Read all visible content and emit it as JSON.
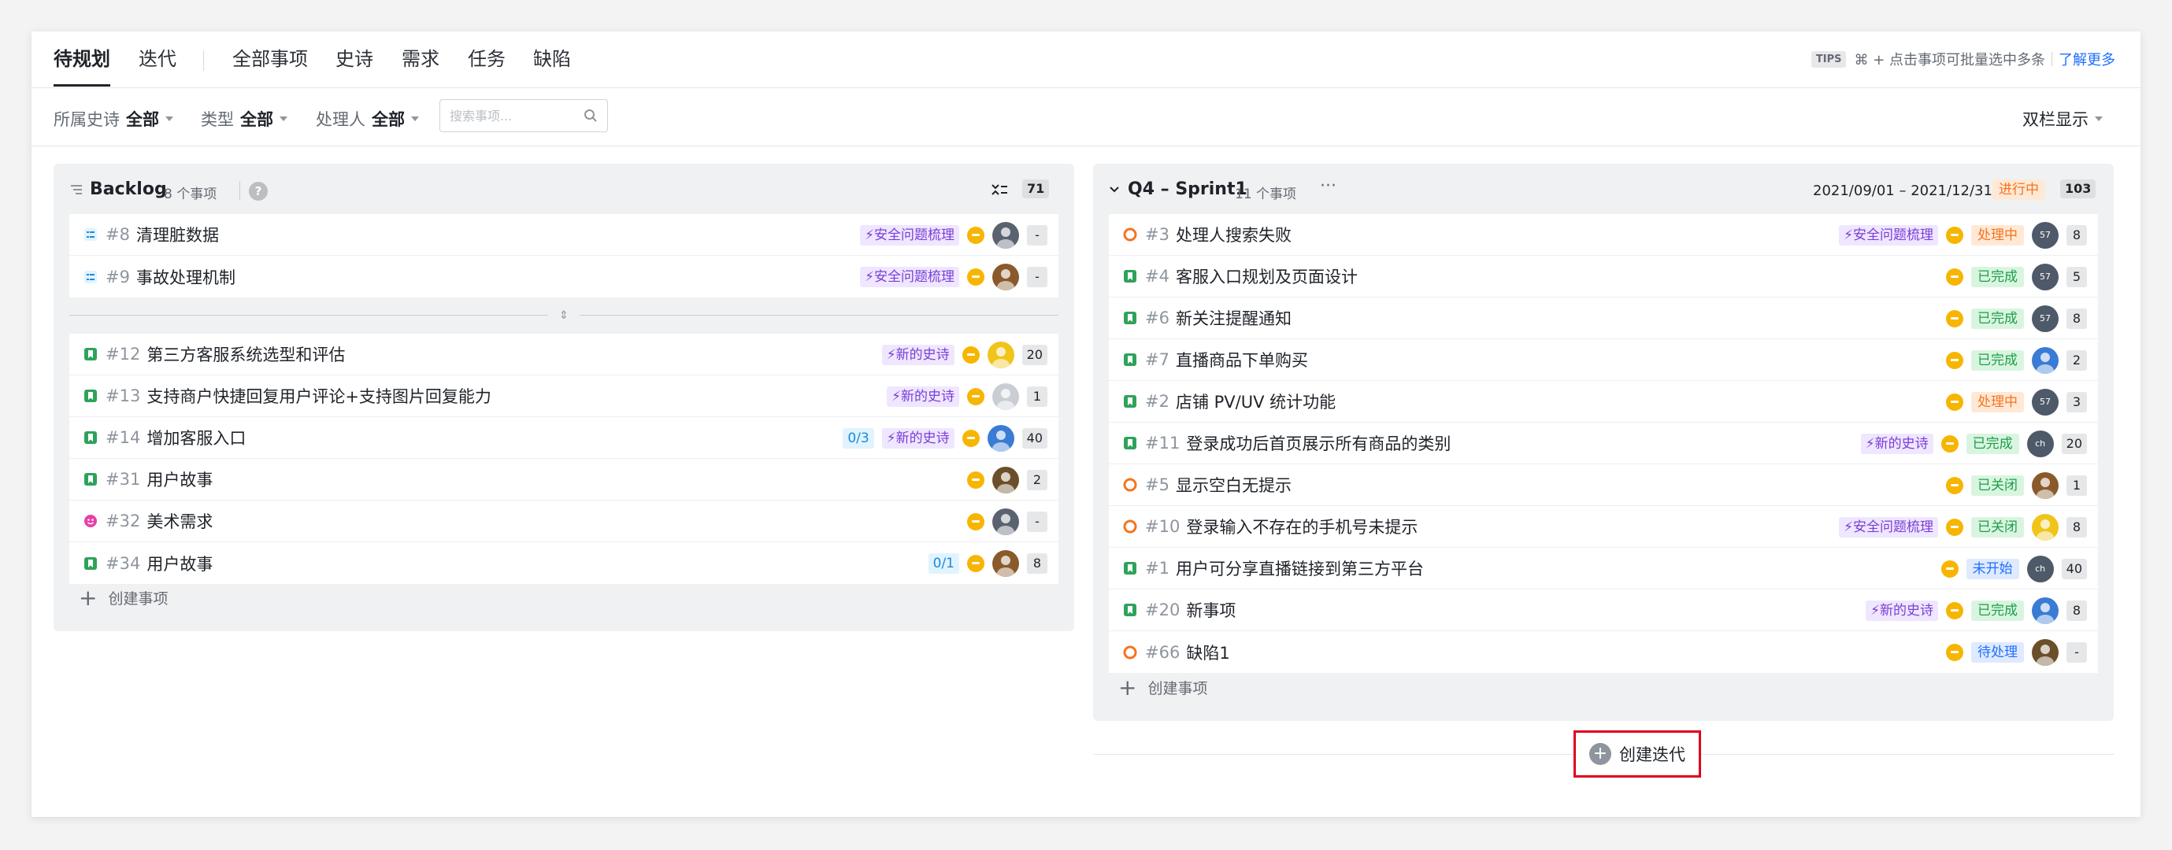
{
  "tabs": [
    "待规划",
    "迭代",
    "全部事项",
    "史诗",
    "需求",
    "任务",
    "缺陷"
  ],
  "tips": {
    "badge": "TIPS",
    "text": "⌘ + 点击事项可批量选中多条",
    "link": "了解更多"
  },
  "filters": {
    "epic_label": "所属史诗",
    "epic_value": "全部",
    "type_label": "类型",
    "type_value": "全部",
    "assignee_label": "处理人",
    "assignee_value": "全部",
    "search_placeholder": "搜索事项...",
    "view_mode": "双栏显示"
  },
  "backlog": {
    "title": "Backlog",
    "count": "8 个事项",
    "total": "71",
    "create_label": "创建事项",
    "rows_top": [
      {
        "id": "#8",
        "title": "清理脏数据",
        "epic": "安全问题梳理",
        "estimate": "-",
        "type": "task"
      },
      {
        "id": "#9",
        "title": "事故处理机制",
        "epic": "安全问题梳理",
        "estimate": "-",
        "type": "task"
      }
    ],
    "rows_bottom": [
      {
        "id": "#12",
        "title": "第三方客服系统选型和评估",
        "epic": "新的史诗",
        "sub": "",
        "estimate": "20",
        "type": "story"
      },
      {
        "id": "#13",
        "title": "支持商户快捷回复用户评论+支持图片回复能力",
        "epic": "新的史诗",
        "sub": "",
        "estimate": "1",
        "type": "story"
      },
      {
        "id": "#14",
        "title": "增加客服入口",
        "epic": "新的史诗",
        "sub": "0/3",
        "estimate": "40",
        "type": "story"
      },
      {
        "id": "#31",
        "title": "用户故事",
        "epic": "",
        "sub": "",
        "estimate": "2",
        "type": "story"
      },
      {
        "id": "#32",
        "title": "美术需求",
        "epic": "",
        "sub": "",
        "estimate": "-",
        "type": "art"
      },
      {
        "id": "#34",
        "title": "用户故事",
        "epic": "",
        "sub": "0/1",
        "estimate": "8",
        "type": "story"
      }
    ]
  },
  "sprint": {
    "title": "Q4 – Sprint1",
    "count": "11 个事项",
    "more": "···",
    "dates": "2021/09/01 – 2021/12/31",
    "state": "进行中",
    "total": "103",
    "create_label": "创建事项",
    "rows": [
      {
        "id": "#3",
        "title": "处理人搜索失败",
        "epic": "安全问题梳理",
        "status": "处理中",
        "status_color": "orange",
        "estimate": "8",
        "type": "bug",
        "avatar": "57"
      },
      {
        "id": "#4",
        "title": "客服入口规划及页面设计",
        "epic": "",
        "status": "已完成",
        "status_color": "green",
        "estimate": "5",
        "type": "story",
        "avatar": "57"
      },
      {
        "id": "#6",
        "title": "新关注提醒通知",
        "epic": "",
        "status": "已完成",
        "status_color": "green",
        "estimate": "8",
        "type": "story",
        "avatar": "57"
      },
      {
        "id": "#7",
        "title": "直播商品下单购买",
        "epic": "",
        "status": "已完成",
        "status_color": "green",
        "estimate": "2",
        "type": "story",
        "avatar": ""
      },
      {
        "id": "#2",
        "title": "店铺 PV/UV 统计功能",
        "epic": "",
        "status": "处理中",
        "status_color": "orange",
        "estimate": "3",
        "type": "story",
        "avatar": "57"
      },
      {
        "id": "#11",
        "title": "登录成功后首页展示所有商品的类别",
        "epic": "新的史诗",
        "status": "已完成",
        "status_color": "green",
        "estimate": "20",
        "type": "story",
        "avatar": "ch"
      },
      {
        "id": "#5",
        "title": "显示空白无提示",
        "epic": "",
        "status": "已关闭",
        "status_color": "green",
        "estimate": "1",
        "type": "bug",
        "avatar": ""
      },
      {
        "id": "#10",
        "title": "登录输入不存在的手机号未提示",
        "epic": "安全问题梳理",
        "status": "已关闭",
        "status_color": "green",
        "estimate": "8",
        "type": "bug",
        "avatar": ""
      },
      {
        "id": "#1",
        "title": "用户可分享直播链接到第三方平台",
        "epic": "",
        "status": "未开始",
        "status_color": "blue",
        "estimate": "40",
        "type": "story",
        "avatar": "ch"
      },
      {
        "id": "#20",
        "title": "新事项",
        "epic": "新的史诗",
        "status": "已完成",
        "status_color": "green",
        "estimate": "8",
        "type": "story",
        "avatar": ""
      },
      {
        "id": "#66",
        "title": "缺陷1",
        "epic": "",
        "status": "待处理",
        "status_color": "blue",
        "estimate": "-",
        "type": "bug",
        "avatar": ""
      }
    ]
  },
  "create_iteration": "创建迭代"
}
